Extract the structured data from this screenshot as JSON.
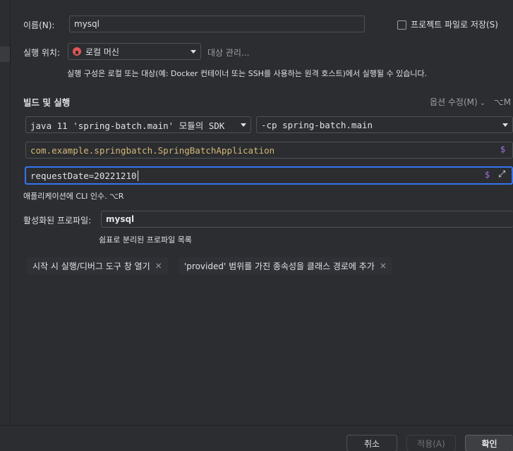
{
  "name": {
    "label": "이름(N):",
    "value": "mysql"
  },
  "store_project": {
    "label": "프로젝트 파일로 저장(S)"
  },
  "run_on": {
    "label": "실행 위치:",
    "value": "로컬 머신",
    "manage_link": "대상 관리...",
    "hint": "실행 구성은 로컬 또는 대상(예: Docker 컨테이너 또는 SSH를 사용하는 원격 호스트)에서 실행될 수 있습니다."
  },
  "build_run": {
    "title": "빌드 및 실행",
    "modify_options": "옵션 수정(M)",
    "modify_shortcut": "⌥M",
    "sdk": "java 11 'spring-batch.main' 모듈의 SDK",
    "classpath": "-cp spring-batch.main",
    "main_class": "com.example.springbatch.SpringBatchApplication",
    "program_args": "requestDate=20221210",
    "args_hint": "애플리케이션에 CLI 인수. ⌥R",
    "dollar": "$"
  },
  "profiles": {
    "label": "활성화된 프로파일:",
    "value": "mysql",
    "hint": "쉼표로 분리된 프로파일 목록"
  },
  "tags": [
    {
      "label": "시작 시 실행/디버그 도구 창 열기"
    },
    {
      "label": "'provided' 범위를 가진 종속성을 클래스 경로에 추가"
    }
  ],
  "buttons": {
    "cancel": "취소",
    "apply": "적용(A)",
    "ok": "확인"
  }
}
